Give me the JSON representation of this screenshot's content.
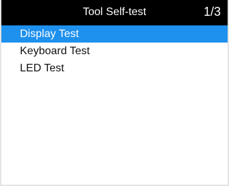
{
  "header": {
    "title": "Tool Self-test",
    "page_indicator": "1/3"
  },
  "menu": {
    "items": [
      {
        "label": "Display Test",
        "selected": true
      },
      {
        "label": "Keyboard Test",
        "selected": false
      },
      {
        "label": "LED Test",
        "selected": false
      }
    ]
  },
  "colors": {
    "header_background": "#000000",
    "header_text": "#ffffff",
    "selection_background": "#1e90ee",
    "selection_text": "#ffffff",
    "item_text": "#111111",
    "screen_background": "#ffffff"
  }
}
